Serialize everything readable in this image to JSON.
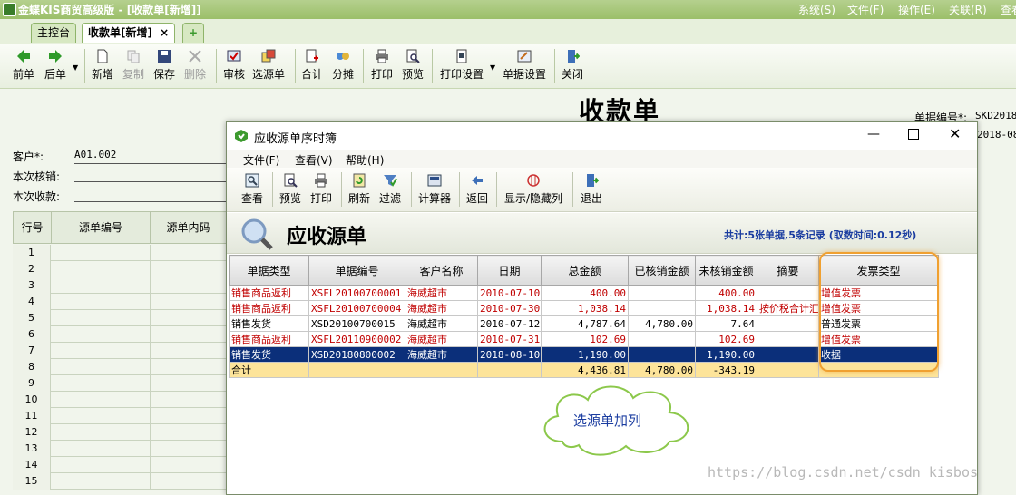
{
  "app": {
    "title": "金蝶KIS商贸高级版 - [收款单[新增]]",
    "menus": [
      "系统(S)",
      "文件(F)",
      "操作(E)",
      "关联(R)",
      "查看"
    ]
  },
  "tabs": [
    {
      "label": "主控台"
    },
    {
      "label": "收款单[新增]",
      "close": "×"
    },
    {
      "label": "+"
    }
  ],
  "toolbar": [
    {
      "label": "前单"
    },
    {
      "label": "后单"
    },
    {
      "label": "新增"
    },
    {
      "label": "复制"
    },
    {
      "label": "保存"
    },
    {
      "label": "删除"
    },
    {
      "label": "审核"
    },
    {
      "label": "选源单"
    },
    {
      "label": "合计"
    },
    {
      "label": "分摊"
    },
    {
      "label": "打印"
    },
    {
      "label": "预览"
    },
    {
      "label": "打印设置"
    },
    {
      "label": "单据设置"
    },
    {
      "label": "关闭"
    }
  ],
  "form": {
    "title": "收款单",
    "doc_no_label": "单据编号*:",
    "doc_no_value": "SKD20180",
    "date_value": "2018-08-",
    "customer_label": "客户*:",
    "customer_value": "A01.002",
    "write_off_label": "本次核销:",
    "receipt_label": "本次收款:"
  },
  "left_grid": {
    "headers": [
      "行号",
      "源单编号",
      "源单内码"
    ],
    "rows": [
      "1",
      "2",
      "3",
      "4",
      "5",
      "6",
      "7",
      "8",
      "9",
      "10",
      "11",
      "12",
      "13",
      "14",
      "15"
    ]
  },
  "dialog": {
    "title": "应收源单序时簿",
    "menus": [
      "文件(F)",
      "查看(V)",
      "帮助(H)"
    ],
    "toolbar": [
      {
        "label": "查看"
      },
      {
        "label": "预览"
      },
      {
        "label": "打印"
      },
      {
        "label": "刷新"
      },
      {
        "label": "过滤"
      },
      {
        "label": "计算器"
      },
      {
        "label": "返回"
      },
      {
        "label": "显示/隐藏列"
      },
      {
        "label": "退出"
      }
    ],
    "heading": "应收源单",
    "summary": "共计:5张单据,5条记录 (取数时间:0.12秒)",
    "columns": [
      "单据类型",
      "单据编号",
      "客户名称",
      "日期",
      "总金额",
      "已核销金额",
      "未核销金额",
      "摘要",
      "发票类型"
    ],
    "rows": [
      {
        "type": "销售商品返利",
        "no": "XSFL20100700001",
        "customer": "海威超市",
        "date": "2010-07-10",
        "total": "400.00",
        "written": "",
        "unwritten": "400.00",
        "memo": "",
        "invoice": "增值发票",
        "style": "red"
      },
      {
        "type": "销售商品返利",
        "no": "XSFL20100700004",
        "customer": "海威超市",
        "date": "2010-07-30",
        "total": "1,038.14",
        "written": "",
        "unwritten": "1,038.14",
        "memo": "按价税合计汇",
        "invoice": "增值发票",
        "style": "red"
      },
      {
        "type": "销售发货",
        "no": "XSD20100700015",
        "customer": "海威超市",
        "date": "2010-07-12",
        "total": "4,787.64",
        "written": "4,780.00",
        "unwritten": "7.64",
        "memo": "",
        "invoice": "普通发票",
        "style": "black"
      },
      {
        "type": "销售商品返利",
        "no": "XSFL20110900002",
        "customer": "海威超市",
        "date": "2010-07-31",
        "total": "102.69",
        "written": "",
        "unwritten": "102.69",
        "memo": "",
        "invoice": "增值发票",
        "style": "red"
      },
      {
        "type": "销售发货",
        "no": "XSD20180800002",
        "customer": "海威超市",
        "date": "2018-08-10",
        "total": "1,190.00",
        "written": "",
        "unwritten": "1,190.00",
        "memo": "",
        "invoice": "收据",
        "style": "sel"
      }
    ],
    "total_row": {
      "type": "合计",
      "total": "4,436.81",
      "written": "4,780.00",
      "unwritten": "-343.19"
    },
    "callout": "选源单加列"
  },
  "watermark": "https://blog.csdn.net/csdn_kisbos",
  "colors": {
    "accent_green": "#9bbf69",
    "selected_row": "#0b2f7a",
    "total_row": "#fde49a",
    "highlight_orange": "#f0a030",
    "red_text": "#c00000"
  }
}
